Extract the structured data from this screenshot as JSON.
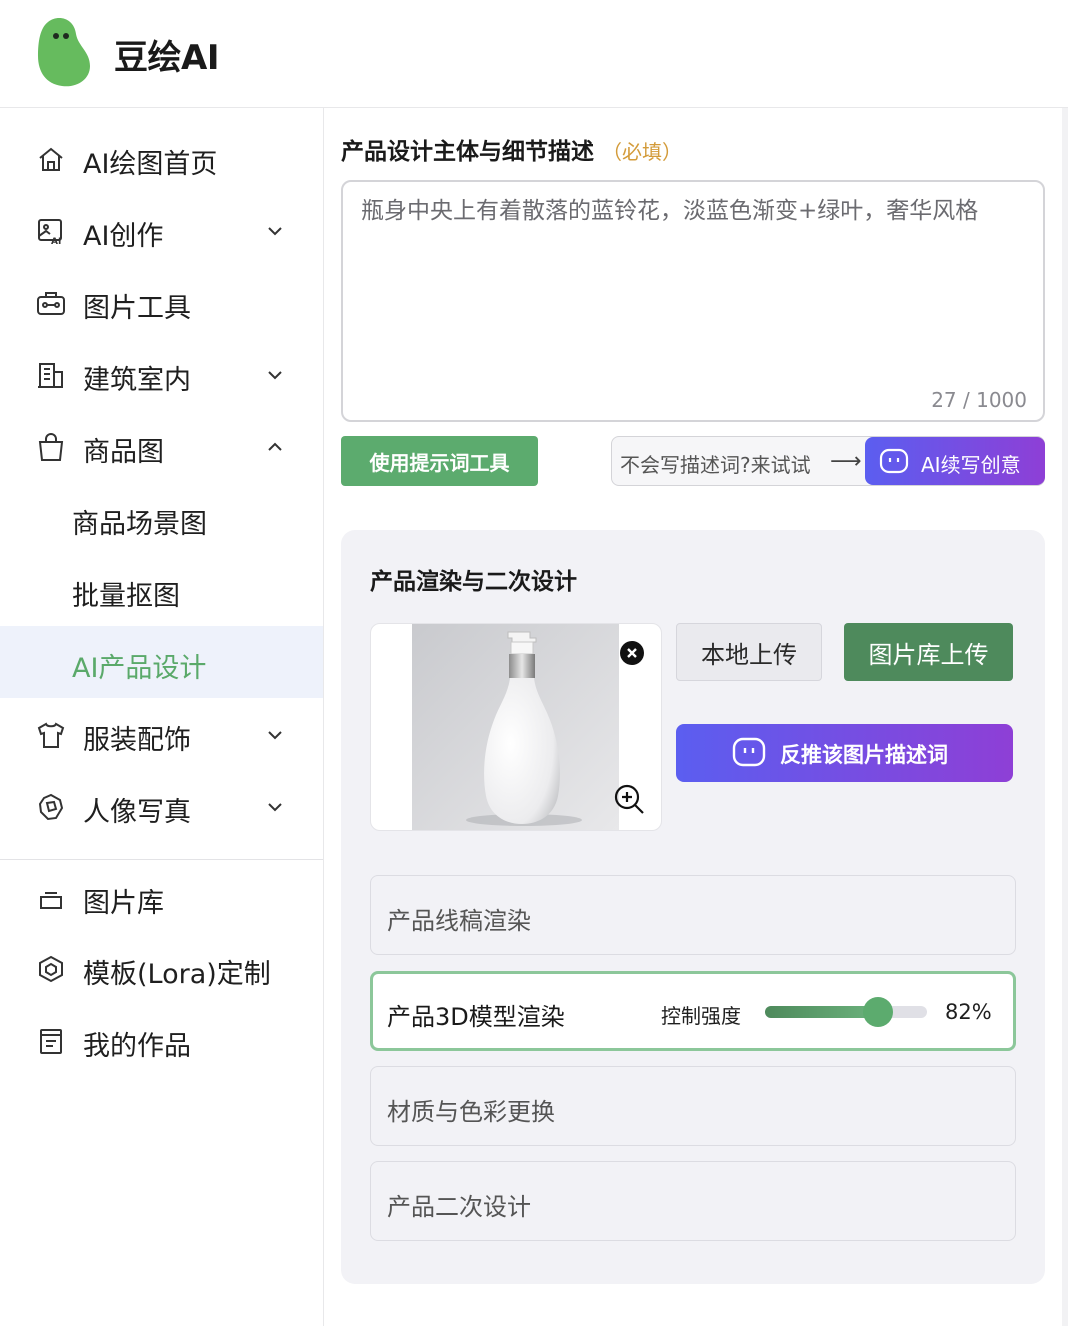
{
  "app": {
    "title": "豆绘AI"
  },
  "colors": {
    "accent": "#5cab6e",
    "accent_dark": "#4e8a5c",
    "ai_gradient_start": "#5b5ef0",
    "ai_gradient_end": "#8e3fd6",
    "required": "#d39b3a"
  },
  "sidebar": {
    "items": [
      {
        "label": "AI绘图首页",
        "icon": "home-icon"
      },
      {
        "label": "AI创作",
        "icon": "ai-image-icon",
        "chevron": "down"
      },
      {
        "label": "图片工具",
        "icon": "toolbox-icon"
      },
      {
        "label": "建筑室内",
        "icon": "building-icon",
        "chevron": "down"
      },
      {
        "label": "商品图",
        "icon": "shopping-bag-icon",
        "chevron": "up"
      },
      {
        "label": "服装配饰",
        "icon": "tshirt-icon",
        "chevron": "down"
      },
      {
        "label": "人像写真",
        "icon": "portrait-icon",
        "chevron": "down"
      }
    ],
    "subitems": [
      {
        "label": "商品场景图",
        "active": false
      },
      {
        "label": "批量抠图",
        "active": false
      },
      {
        "label": "AI产品设计",
        "active": true
      }
    ],
    "bottom_items": [
      {
        "label": "图片库",
        "icon": "image-library-icon"
      },
      {
        "label": "模板(Lora)定制",
        "icon": "model-custom-icon"
      },
      {
        "label": "我的作品",
        "icon": "my-works-icon"
      }
    ]
  },
  "main": {
    "prompt": {
      "title": "产品设计主体与细节描述",
      "required_label": "（必填）",
      "value": "瓶身中央上有着散落的蓝铃花，淡蓝色渐变+绿叶，奢华风格",
      "counter": "27  /  1000"
    },
    "prompt_tool_button": "使用提示词工具",
    "hint_text": "不会写描述词?来试试",
    "hint_arrow": "⟶",
    "ai_continue_button": "AI续写创意",
    "render_panel": {
      "title": "产品渲染与二次设计",
      "local_upload": "本地上传",
      "library_upload": "图片库上传",
      "reverse_prompt": "反推该图片描述词",
      "options": [
        {
          "label": "产品线稿渲染",
          "active": false
        },
        {
          "label": "产品3D模型渲染",
          "active": true
        },
        {
          "label": "材质与色彩更换",
          "active": false
        },
        {
          "label": "产品二次设计",
          "active": false
        }
      ],
      "control": {
        "label": "控制强度",
        "value_text": "82%",
        "value": 0.7
      }
    }
  }
}
